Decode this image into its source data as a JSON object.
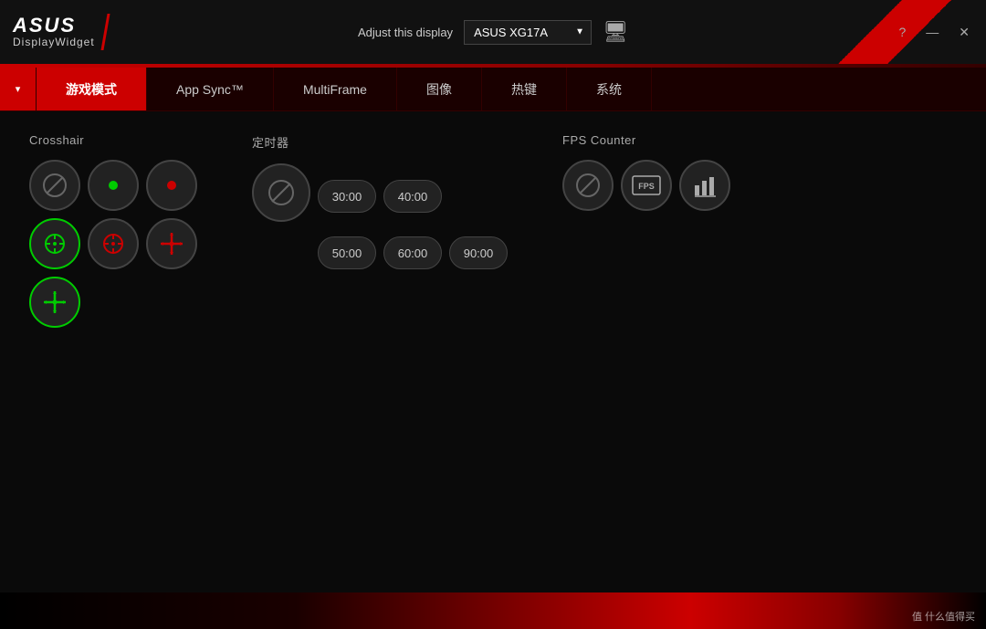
{
  "titlebar": {
    "brand": "ASUS",
    "sub": "DisplayWidget",
    "adjust_label": "Adjust this display",
    "display_value": "ASUS XG17A",
    "btn_help": "?",
    "btn_minimize": "—",
    "btn_close": "✕"
  },
  "tabs": [
    {
      "id": "dropdown",
      "label": "▾",
      "active": false,
      "dropdown": true
    },
    {
      "id": "game-mode",
      "label": "游戏模式",
      "active": true
    },
    {
      "id": "app-sync",
      "label": "App Sync™",
      "active": false
    },
    {
      "id": "multiframe",
      "label": "MultiFrame",
      "active": false
    },
    {
      "id": "image",
      "label": "图像",
      "active": false
    },
    {
      "id": "hotkeys",
      "label": "热键",
      "active": false
    },
    {
      "id": "system",
      "label": "系统",
      "active": false
    }
  ],
  "sections": {
    "crosshair": {
      "title": "Crosshair",
      "buttons": [
        {
          "id": "none",
          "type": "slash"
        },
        {
          "id": "dot-green",
          "type": "dot",
          "color": "#00cc00"
        },
        {
          "id": "dot-red",
          "type": "dot",
          "color": "#cc0000"
        },
        {
          "id": "circle-green",
          "type": "circle-crosshair",
          "color": "#00cc00",
          "selected": true
        },
        {
          "id": "circle-red",
          "type": "circle-crosshair",
          "color": "#cc0000"
        },
        {
          "id": "cross-red",
          "type": "cross",
          "color": "#cc0000"
        },
        {
          "id": "cross-green",
          "type": "cross-alt",
          "color": "#00cc00"
        }
      ]
    },
    "timer": {
      "title": "定时器",
      "options": [
        {
          "id": "none",
          "type": "slash"
        },
        {
          "id": "30",
          "label": "30:00"
        },
        {
          "id": "40",
          "label": "40:00"
        },
        {
          "id": "50",
          "label": "50:00"
        },
        {
          "id": "60",
          "label": "60:00"
        },
        {
          "id": "90",
          "label": "90:00"
        }
      ]
    },
    "fps": {
      "title": "FPS Counter",
      "buttons": [
        {
          "id": "none",
          "type": "slash"
        },
        {
          "id": "fps-text",
          "type": "fps-text"
        },
        {
          "id": "fps-chart",
          "type": "fps-chart"
        }
      ]
    }
  },
  "watermark": "什么值得买"
}
